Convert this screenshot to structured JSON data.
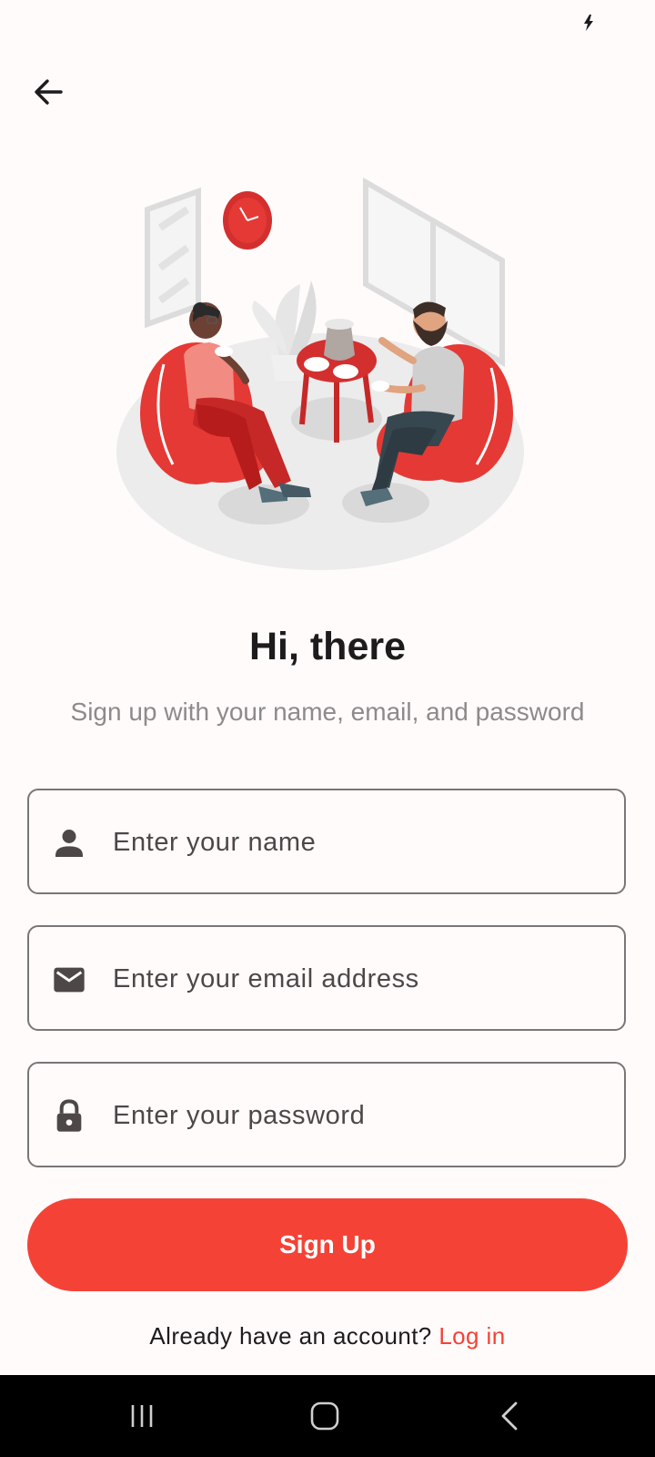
{
  "header": {
    "back_icon": "arrow-left-icon"
  },
  "illustration": {
    "description_icon": "people-chatting-illustration"
  },
  "headline": "Hi, there",
  "subtitle": "Sign up with your name, email, and password",
  "form": {
    "name": {
      "placeholder": "Enter your name",
      "icon": "person-icon",
      "value": ""
    },
    "email": {
      "placeholder": "Enter your email address",
      "icon": "mail-icon",
      "value": ""
    },
    "password": {
      "placeholder": "Enter your password",
      "icon": "lock-icon",
      "value": ""
    }
  },
  "signup_button": "Sign Up",
  "footer": {
    "prompt": "Already have an account?",
    "login_link": "Log in"
  },
  "colors": {
    "accent": "#f44336",
    "background": "#fffbfb",
    "text": "#1d1b1c",
    "muted": "#8e8a8b"
  },
  "nav": {
    "recents_icon": "recents-icon",
    "home_icon": "home-icon",
    "back_icon": "back-chevron-icon"
  }
}
